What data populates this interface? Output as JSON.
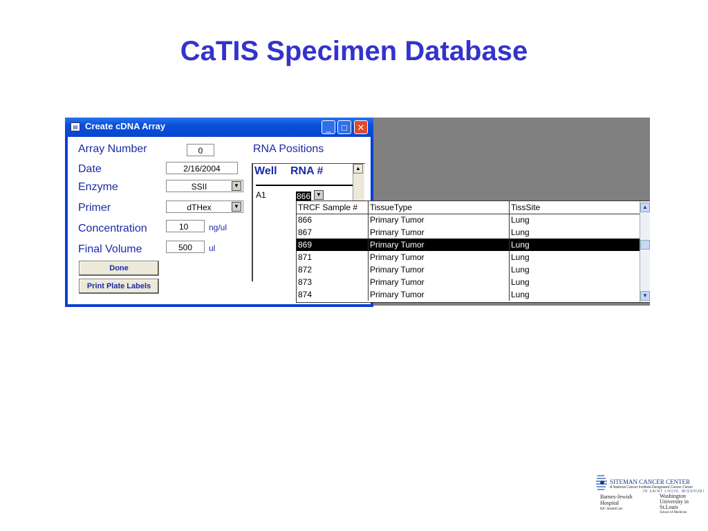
{
  "slide": {
    "title": "CaTIS Specimen Database",
    "title_color": "#3333cc"
  },
  "window": {
    "title": "Create cDNA Array",
    "title_icon": "form-icon",
    "controls": [
      "minimize-icon",
      "maximize-icon",
      "close-icon"
    ]
  },
  "form": {
    "array_number": {
      "label": "Array Number",
      "value": "0"
    },
    "date": {
      "label": "Date",
      "value": "2/16/2004"
    },
    "enzyme": {
      "label": "Enzyme",
      "value": "SSII"
    },
    "primer": {
      "label": "Primer",
      "value": "dTHex"
    },
    "concentration": {
      "label": "Concentration",
      "value": "10",
      "unit": "ng/ul"
    },
    "final_volume": {
      "label": "Final Volume",
      "value": "500",
      "unit": "ul"
    },
    "done_label": "Done",
    "print_label": "Print Plate Labels"
  },
  "rna_positions": {
    "title": "RNA Positions",
    "col_well": "Well",
    "col_rna": "RNA #",
    "row": {
      "well": "A1",
      "rna": "866"
    }
  },
  "dropdown": {
    "columns": [
      "TRCF Sample #",
      "TissueType",
      "TissSite"
    ],
    "rows": [
      [
        "866",
        "Primary Tumor",
        "Lung"
      ],
      [
        "867",
        "Primary Tumor",
        "Lung"
      ],
      [
        "869",
        "Primary Tumor",
        "Lung"
      ],
      [
        "871",
        "Primary Tumor",
        "Lung"
      ],
      [
        "872",
        "Primary Tumor",
        "Lung"
      ],
      [
        "873",
        "Primary Tumor",
        "Lung"
      ],
      [
        "874",
        "Primary Tumor",
        "Lung"
      ]
    ],
    "selected_row": "869"
  },
  "logo": {
    "line1": "SITEMAN CANCER CENTER",
    "line2": "A National Cancer Institute-Designated Cancer Center",
    "line3": "IN SAINT LOUIS, MISSOURI",
    "left_name": "Barnes-Jewish Hospital",
    "left_sub": "BJC HealthCare",
    "right_name": "Washington University in St.Louis",
    "right_sub": "School of Medicine"
  }
}
